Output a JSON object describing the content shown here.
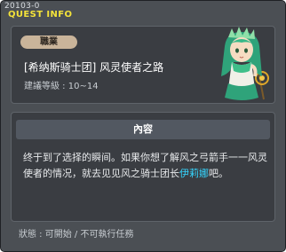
{
  "window": {
    "id_text": "20103-0",
    "title": "QUEST INFO"
  },
  "quest": {
    "job_badge": "職業",
    "name": "[希纳斯骑士团] 风灵使者之路",
    "level_label": "建議等級 : 10~14"
  },
  "content": {
    "header": "內容",
    "body_before": "终于到了选择的瞬间。如果你想了解风之弓箭手一一风灵使者的情况，就去见见风之骑士团长",
    "npc_name": "伊莉娜",
    "body_after": "吧。"
  },
  "status": {
    "text": "狀態 : 可開始 / 不可執行任務"
  },
  "icons": {
    "npc_portrait": "wind-archer-npc-portrait"
  },
  "colors": {
    "window_bg": "#4b4f54",
    "title_yellow": "#f3e23a",
    "npc_highlight": "#35d6ff",
    "badge_bg": "#c9b49a"
  }
}
